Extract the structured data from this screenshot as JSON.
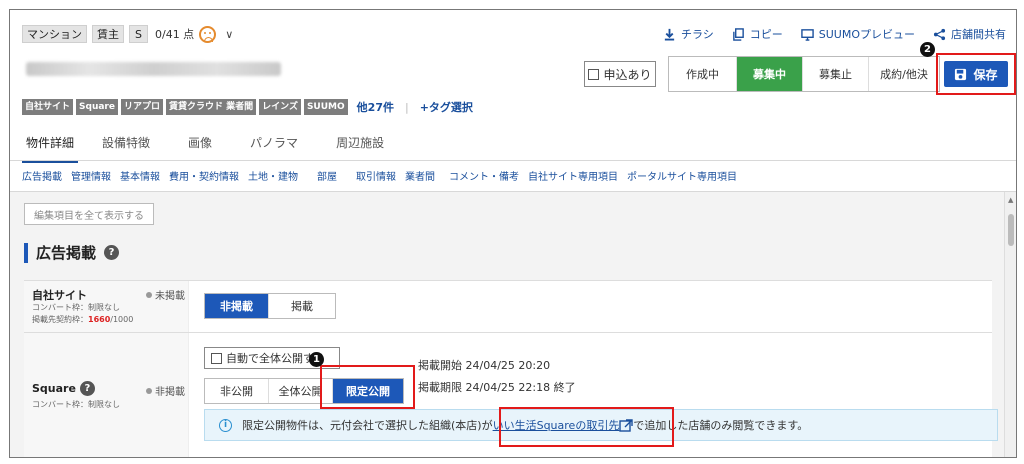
{
  "header": {
    "chips": [
      "マンション",
      "賃主",
      "S"
    ],
    "points": "0/41 点",
    "links": [
      {
        "label": "チラシ",
        "icon": "download-icon"
      },
      {
        "label": "コピー",
        "icon": "copy-icon"
      },
      {
        "label": "SUUMOプレビュー",
        "icon": "monitor-icon"
      },
      {
        "label": "店舗間共有",
        "icon": "share-icon"
      }
    ]
  },
  "status": {
    "apply_label": "申込あり",
    "buttons": [
      "作成中",
      "募集中",
      "募集止",
      "成約/他決"
    ],
    "active": "募集中",
    "save_label": "保存"
  },
  "markers": {
    "one": "1",
    "two": "2"
  },
  "tags": [
    "自社サイト",
    "Square",
    "リアプロ",
    "賃貸クラウド 業者間",
    "レインズ",
    "SUUMO"
  ],
  "tags_more": "他27件",
  "tags_add": "+タグ選択",
  "tabs": [
    "物件詳細",
    "設備特徴",
    "画像",
    "パノラマ",
    "周辺施設"
  ],
  "section_nav": [
    "広告掲載",
    "管理情報",
    "基本情報",
    "費用・契約情報",
    "土地・建物",
    "部屋",
    "取引情報",
    "業者間",
    "コメント・備考",
    "自社サイト専用項目",
    "ポータルサイト専用項目"
  ],
  "show_all_label": "編集項目を全て表示する",
  "section_title": "広告掲載",
  "jisha": {
    "label": "自社サイト",
    "status": "未掲載",
    "sub1": "コンバート枠：制限なし",
    "sub2_prefix": "掲載先契約枠：",
    "sub2_used": "1660",
    "sub2_total": "/1000",
    "options": [
      "非掲載",
      "掲載"
    ],
    "selected": "非掲載"
  },
  "square": {
    "label": "Square",
    "status": "非掲載",
    "sub1": "コンバート枠：制限なし",
    "auto_label": "自動で全体公開する",
    "options": [
      "非公開",
      "全体公開",
      "限定公開"
    ],
    "selected": "限定公開",
    "start": "掲載開始 24/04/25 20:20",
    "end": "掲載期限 24/04/25 22:18 終了",
    "info_prefix": "限定公開物件は、元付会社で選択した組織(本店)が",
    "info_link": "いい生活Squareの取引先",
    "info_suffix": "で追加した店舗のみ閲覧できます。"
  },
  "colors": {
    "accent": "#1d58b8",
    "active_green": "#3aa14a",
    "highlight": "#e21a1a"
  }
}
